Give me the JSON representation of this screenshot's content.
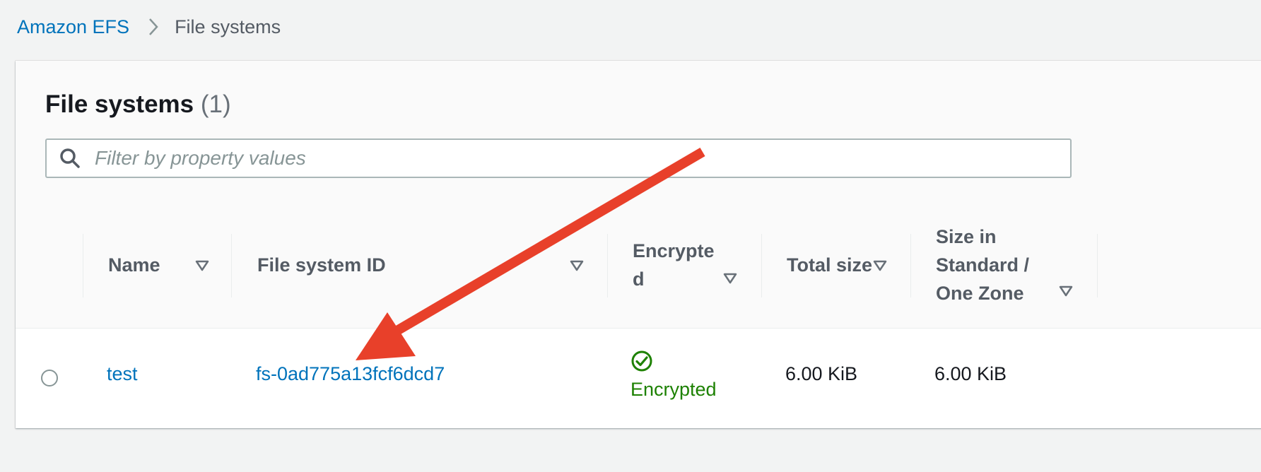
{
  "breadcrumb": {
    "root": "Amazon EFS",
    "current": "File systems"
  },
  "panel": {
    "title": "File systems",
    "count": "(1)"
  },
  "filter": {
    "placeholder": "Filter by property values",
    "icon": "search-icon"
  },
  "table": {
    "columns": [
      {
        "label": "Name"
      },
      {
        "label": "File system ID"
      },
      {
        "label_line1": "Encrypte",
        "label_line2": "d"
      },
      {
        "label": "Total size"
      },
      {
        "label_line1": "Size in",
        "label_line2": "Standard /",
        "label_line3": "One Zone"
      }
    ],
    "rows": [
      {
        "name": "test",
        "file_system_id": "fs-0ad775a13fcf6dcd7",
        "encrypted": "Encrypted",
        "total_size": "6.00 KiB",
        "size_standard": "6.00 KiB"
      }
    ]
  },
  "colors": {
    "link": "#0073bb",
    "success": "#1d8102",
    "annotation_arrow": "#e8402a"
  }
}
